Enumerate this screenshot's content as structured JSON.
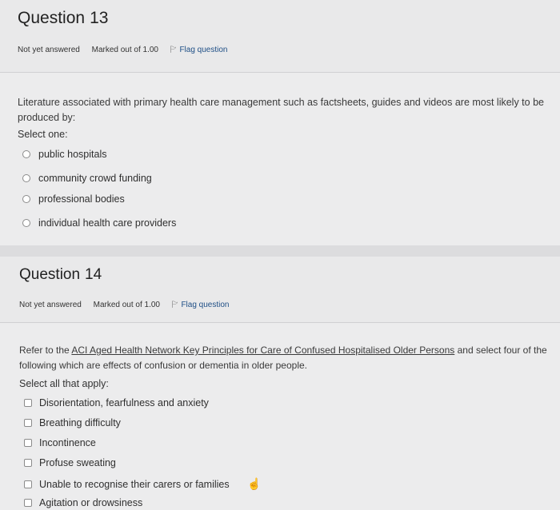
{
  "q13": {
    "label": "Question",
    "number": "13",
    "status": "Not yet answered",
    "marked": "Marked out of 1.00",
    "flag": "Flag question",
    "text": "Literature associated with primary health care management such as factsheets, guides and videos are most likely to be produced by:",
    "select_label": "Select one:",
    "options": [
      "public hospitals",
      "community crowd funding",
      "professional bodies",
      "individual health care providers"
    ]
  },
  "q14": {
    "label": "Question",
    "number": "14",
    "status": "Not yet answered",
    "marked": "Marked out of 1.00",
    "flag": "Flag question",
    "text_before": "Refer to the ",
    "link": "ACI Aged Health Network Key Principles for Care of Confused Hospitalised Older Persons",
    "text_after": " and select four of the following which are effects of confusion or dementia in older people.",
    "select_label": "Select all that apply:",
    "options": [
      "Disorientation, fearfulness and anxiety",
      "Breathing difficulty",
      "Incontinence",
      "Profuse sweating",
      "Unable to recognise their carers or families",
      "Agitation or drowsiness"
    ]
  },
  "icons": {
    "flag": "flag-icon",
    "cursor": "hand-pointer-icon"
  }
}
